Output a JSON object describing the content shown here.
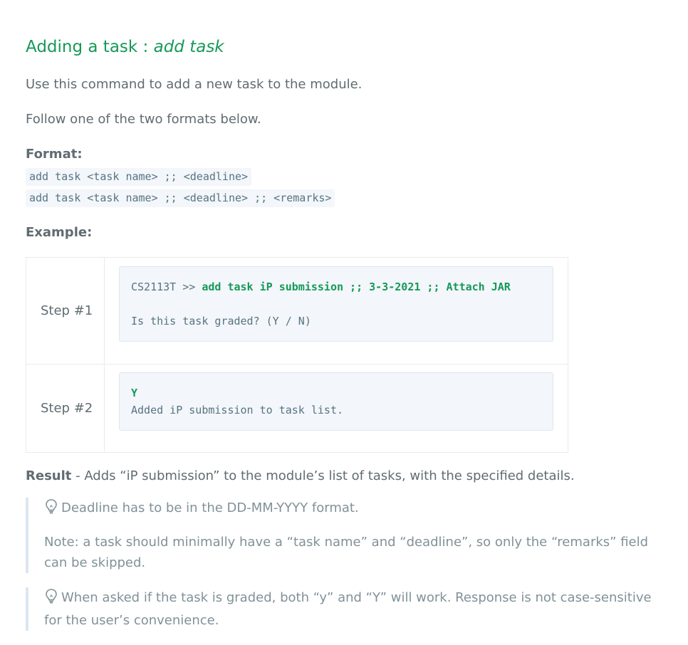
{
  "heading": {
    "prefix": "Adding a task : ",
    "command": "add task"
  },
  "intro": "Use this command to add a new task to the module.",
  "formats_intro": "Follow one of the two formats below.",
  "format_label": "Format:",
  "formats": [
    "add task <task name> ;; <deadline>",
    "add task <task name> ;; <deadline> ;; <remarks>"
  ],
  "example_label": "Example:",
  "steps": [
    {
      "label": "Step #1",
      "prompt": "CS2113T >> ",
      "command": "add task iP submission ;; 3-3-2021 ;; Attach JAR",
      "output": "Is this task graded? (Y / N)"
    },
    {
      "label": "Step #2",
      "command": "Y",
      "output": "Added iP submission to task list."
    }
  ],
  "result": {
    "label": "Result",
    "text": " - Adds “iP submission” to the module’s list of tasks, with the specified details."
  },
  "notes": [
    {
      "icon": "lightbulb-icon",
      "paragraphs": [
        "Deadline has to be in the DD-MM-YYYY format.",
        "Note: a task should minimally have a “task name” and “deadline”, so only the “remarks” field can be skipped."
      ]
    },
    {
      "icon": "lightbulb-icon",
      "paragraphs": [
        "When asked if the task is graded, both “y” and “Y” will work. Response is not case-sensitive for the user’s convenience."
      ]
    }
  ],
  "colors": {
    "heading": "#159957",
    "text": "#606c71",
    "code_text": "#567482",
    "code_bg": "#f3f6fa",
    "quote_text": "#819198",
    "quote_border": "#dce6f0"
  }
}
